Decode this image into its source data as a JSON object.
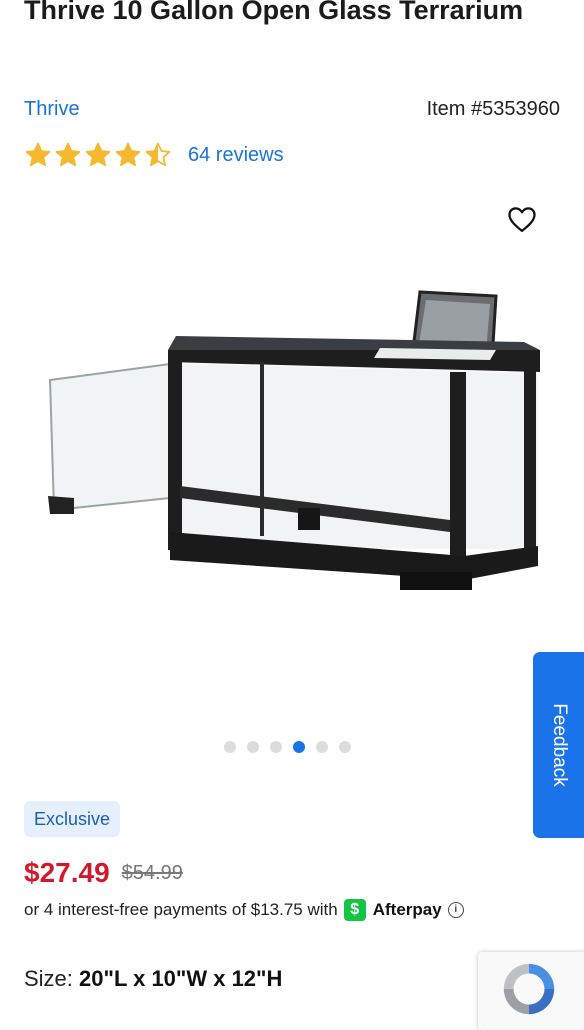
{
  "product": {
    "title": "Thrive 10 Gallon Open Glass Terrarium",
    "brand": "Thrive",
    "item_number": "Item #5353960",
    "rating": 4.5,
    "reviews_label": "64 reviews"
  },
  "gallery": {
    "image_count": 6,
    "active_index": 3
  },
  "feedback": {
    "label": "Feedback"
  },
  "badge": {
    "label": "Exclusive"
  },
  "pricing": {
    "price": "$27.49",
    "was_price": "$54.99",
    "installment_text": "or 4 interest-free payments of $13.75 with",
    "provider_logo_glyph": "$",
    "provider_name": "Afterpay",
    "info_glyph": "i"
  },
  "size": {
    "label": "Size:",
    "value": "20\"L x 10\"W x 12\"H"
  },
  "colors": {
    "link": "#1a73d9",
    "price": "#d0192a",
    "accent": "#1a73e8",
    "star": "#f5b82e",
    "afterpay": "#14c443"
  },
  "icons": {
    "favorite": "heart-outline-icon",
    "star": "star-icon",
    "captcha": "recaptcha-icon",
    "info": "info-icon"
  }
}
